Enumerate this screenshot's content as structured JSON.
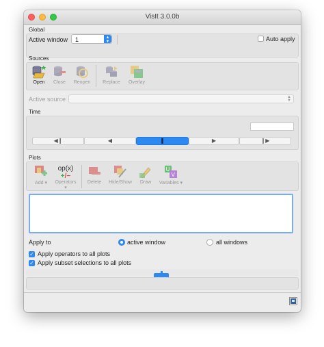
{
  "window": {
    "title": "VisIt 3.0.0b"
  },
  "global": {
    "section_label": "Global",
    "active_window_label": "Active window",
    "active_window_value": "1",
    "auto_apply_label": "Auto apply",
    "auto_apply_checked": false
  },
  "sources": {
    "section_label": "Sources",
    "buttons": [
      {
        "label": "Open",
        "icon": "open-icon",
        "enabled": true
      },
      {
        "label": "Close",
        "icon": "close-database-icon",
        "enabled": false
      },
      {
        "label": "Reopen",
        "icon": "reopen-icon",
        "enabled": false
      },
      {
        "label": "Replace",
        "icon": "replace-icon",
        "enabled": false
      },
      {
        "label": "Overlay",
        "icon": "overlay-icon",
        "enabled": false
      }
    ],
    "active_source_label": "Active source",
    "active_source_value": ""
  },
  "time": {
    "section_label": "Time",
    "time_value": "",
    "controls": [
      "◀❙",
      "◀",
      "❚",
      "▶",
      "❙▶"
    ]
  },
  "plots": {
    "section_label": "Plots",
    "buttons": [
      {
        "label": "Add",
        "icon": "add-plot-icon",
        "enabled": false
      },
      {
        "label": "Operators",
        "icon": "operators-icon",
        "enabled": false
      },
      {
        "label": "Delete",
        "icon": "delete-icon",
        "enabled": false
      },
      {
        "label": "Hide/Show",
        "icon": "hide-show-icon",
        "enabled": false
      },
      {
        "label": "Draw",
        "icon": "draw-icon",
        "enabled": false
      },
      {
        "label": "Variables",
        "icon": "variables-icon",
        "enabled": false
      }
    ],
    "operators_glyph_top": "op(",
    "operators_glyph_mid": "x",
    "operators_glyph_end": ")",
    "variables_glyph": "U V"
  },
  "apply_to": {
    "label": "Apply to",
    "options": [
      "active window",
      "all windows"
    ],
    "selected": "active window",
    "apply_operators_label": "Apply operators to all plots",
    "apply_operators_checked": true,
    "apply_subset_label": "Apply subset selections to all plots",
    "apply_subset_checked": true
  },
  "colors": {
    "accent": "#2d88f0",
    "window_bg": "#ececec"
  }
}
